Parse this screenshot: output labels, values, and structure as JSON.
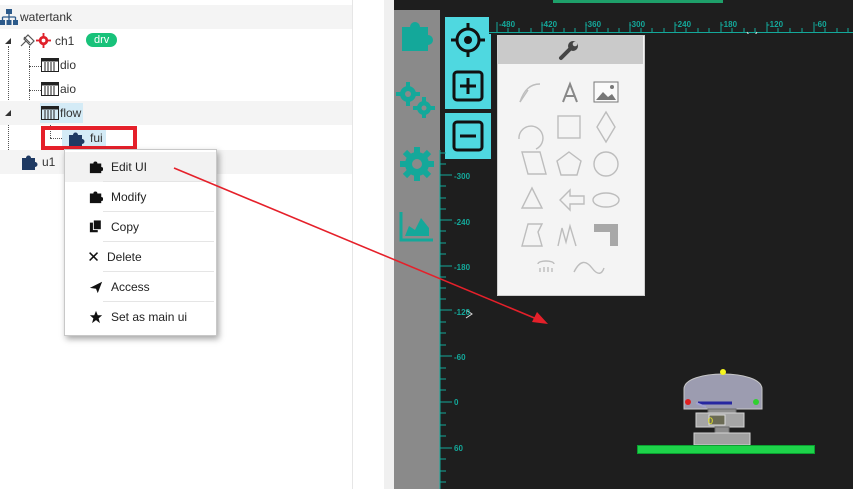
{
  "tree": {
    "root": "watertank",
    "ch1": "ch1",
    "ch1_badge": "drv",
    "dio": "dio",
    "aio": "aio",
    "flow": "flow",
    "fui": "fui",
    "u1": "u1"
  },
  "menu": {
    "items": [
      {
        "label": "Edit UI",
        "icon": "puzzle-icon"
      },
      {
        "label": "Modify",
        "icon": "puzzle-icon"
      },
      {
        "label": "Copy",
        "icon": "copy-icon"
      },
      {
        "label": "Delete",
        "icon": "close-icon"
      },
      {
        "label": "Access",
        "icon": "send-icon"
      },
      {
        "label": "Set as main ui",
        "icon": "star-icon"
      }
    ]
  },
  "ruler": {
    "top": [
      "-480",
      "-420",
      "-360",
      "-300",
      "-240",
      "-180",
      "-120",
      "-60"
    ],
    "left": [
      "-300",
      "-240",
      "-180",
      "-120",
      "-60",
      "0",
      "60"
    ]
  },
  "device": {
    "value": "0"
  },
  "colors": {
    "accent": "#14a89a",
    "button_bg": "#4fd8e0",
    "highlight_red": "#e5202a",
    "badge_green": "#18c27a"
  }
}
